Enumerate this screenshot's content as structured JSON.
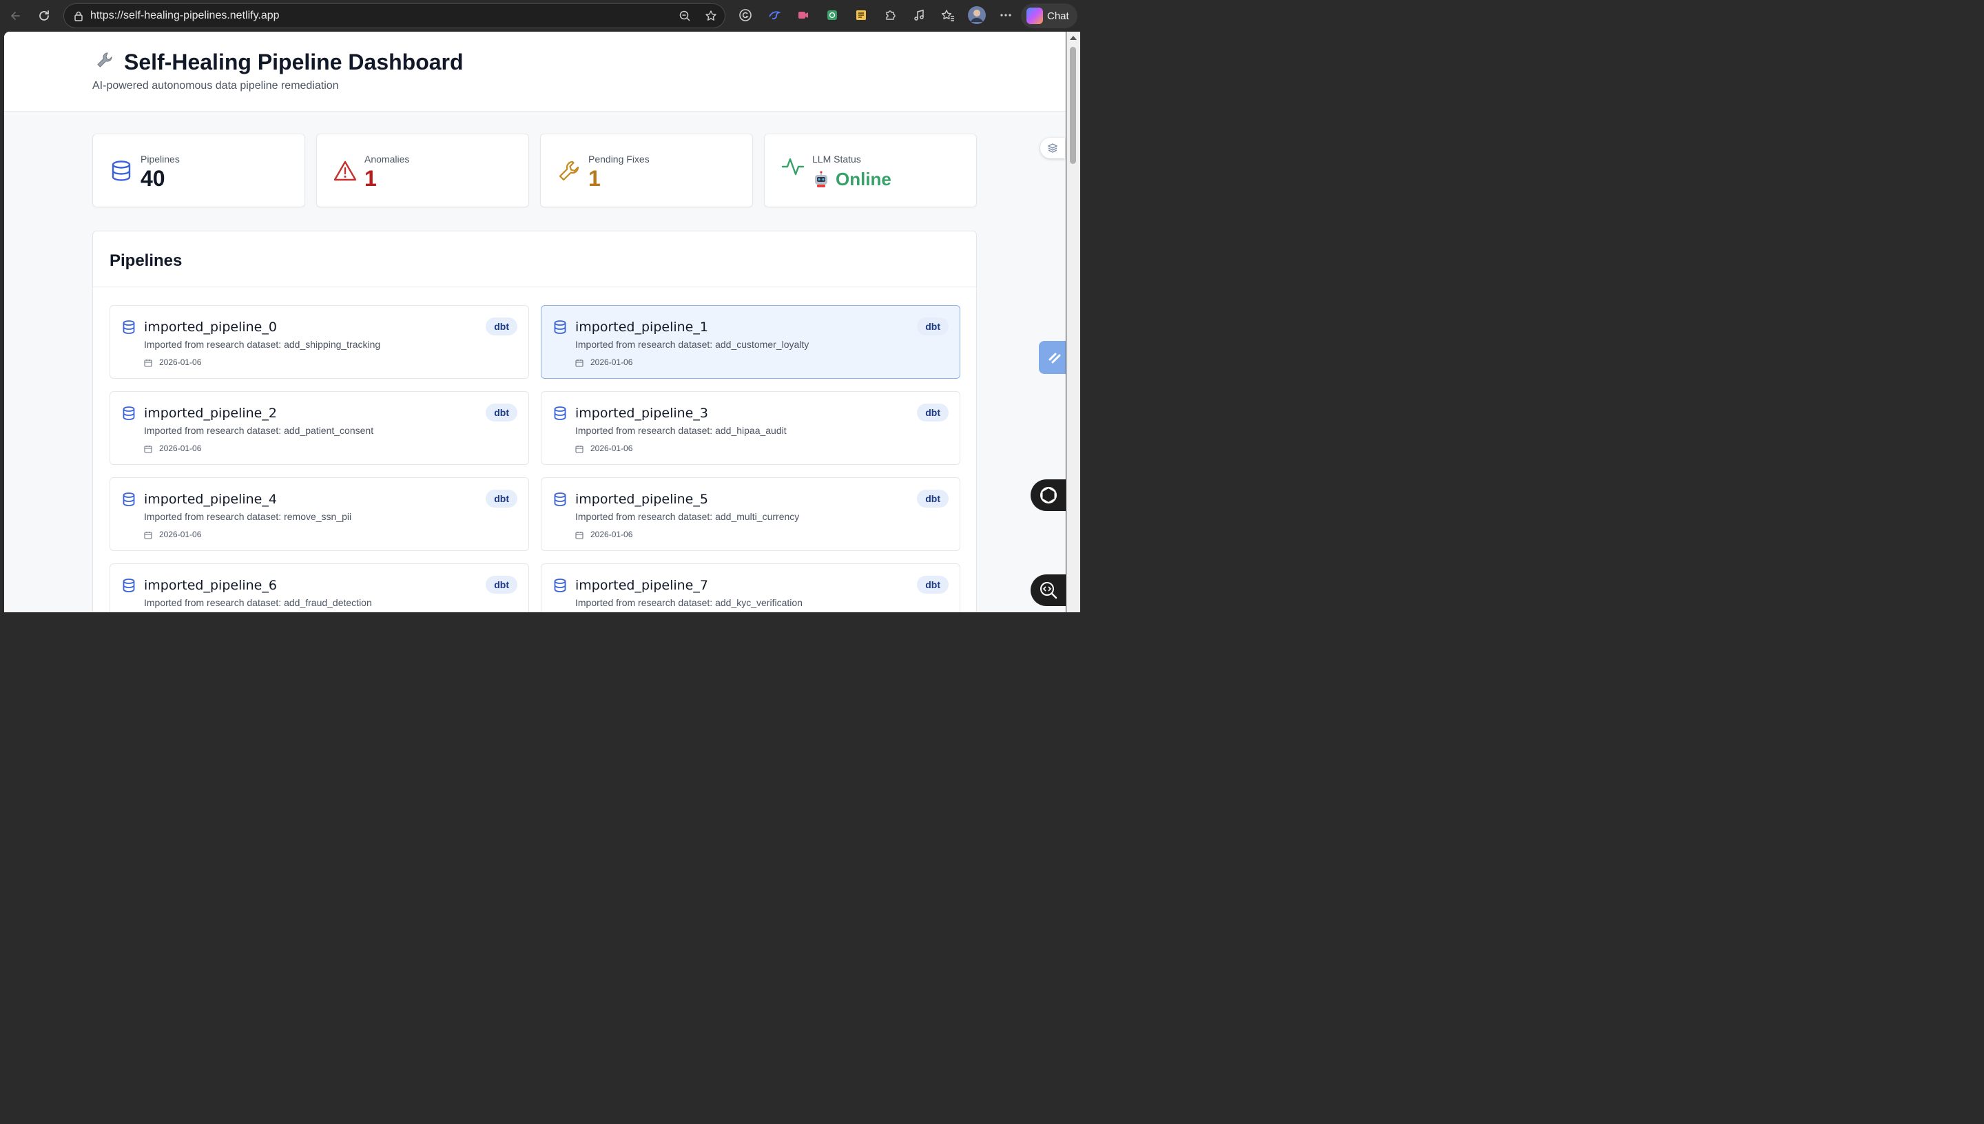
{
  "browser": {
    "url": "https://self-healing-pipelines.netlify.app",
    "chat_label": "Chat"
  },
  "header": {
    "icon": "wrench-emoji",
    "title": "Self-Healing Pipeline Dashboard",
    "subtitle": "AI-powered autonomous data pipeline remediation"
  },
  "stats": [
    {
      "label": "Pipelines",
      "value": "40",
      "icon": "database-icon",
      "color": "#3b63d9"
    },
    {
      "label": "Anomalies",
      "value": "1",
      "icon": "warning-icon",
      "color": "#c53030"
    },
    {
      "label": "Pending Fixes",
      "value": "1",
      "icon": "wrench-icon",
      "color": "#c58a1e"
    },
    {
      "label": "LLM Status",
      "value": "Online",
      "icon": "activity-icon",
      "color": "#38a169"
    }
  ],
  "pipelines_section": {
    "title": "Pipelines",
    "items": [
      {
        "name": "imported_pipeline_0",
        "description": "Imported from research dataset: add_shipping_tracking",
        "date": "2026-01-06",
        "badge": "dbt",
        "selected": false
      },
      {
        "name": "imported_pipeline_1",
        "description": "Imported from research dataset: add_customer_loyalty",
        "date": "2026-01-06",
        "badge": "dbt",
        "selected": true
      },
      {
        "name": "imported_pipeline_2",
        "description": "Imported from research dataset: add_patient_consent",
        "date": "2026-01-06",
        "badge": "dbt",
        "selected": false
      },
      {
        "name": "imported_pipeline_3",
        "description": "Imported from research dataset: add_hipaa_audit",
        "date": "2026-01-06",
        "badge": "dbt",
        "selected": false
      },
      {
        "name": "imported_pipeline_4",
        "description": "Imported from research dataset: remove_ssn_pii",
        "date": "2026-01-06",
        "badge": "dbt",
        "selected": false
      },
      {
        "name": "imported_pipeline_5",
        "description": "Imported from research dataset: add_multi_currency",
        "date": "2026-01-06",
        "badge": "dbt",
        "selected": false
      },
      {
        "name": "imported_pipeline_6",
        "description": "Imported from research dataset: add_fraud_detection",
        "date": "",
        "badge": "dbt",
        "selected": false
      },
      {
        "name": "imported_pipeline_7",
        "description": "Imported from research dataset: add_kyc_verification",
        "date": "",
        "badge": "dbt",
        "selected": false
      }
    ]
  }
}
